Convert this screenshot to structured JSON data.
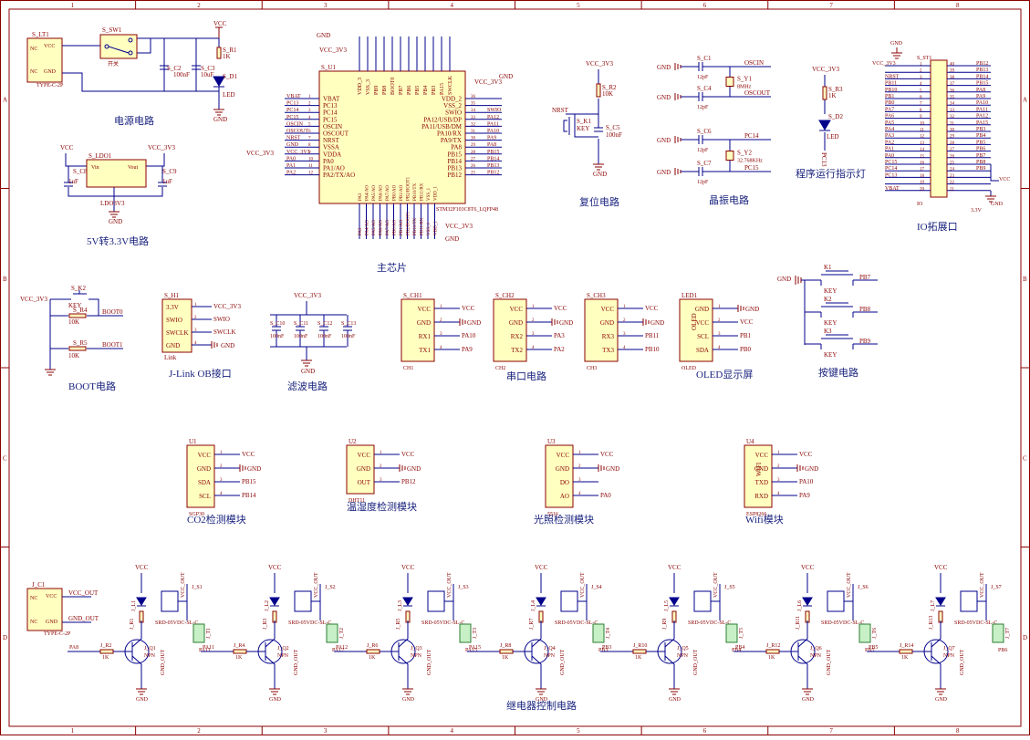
{
  "border": {
    "cols": [
      "1",
      "2",
      "3",
      "4",
      "5",
      "6",
      "7",
      "8"
    ],
    "rows": [
      "A",
      "B",
      "C",
      "D"
    ]
  },
  "sections": {
    "power": "电源电路",
    "ldo": "5V转3.3V电路",
    "mcu": "主芯片",
    "reset": "复位电路",
    "crystal": "晶振电路",
    "led": "程序运行指示灯",
    "io": "IO拓展口",
    "boot": "BOOT电路",
    "jlink": "J-Link OB接口",
    "filter": "滤波电路",
    "uart": "串口电路",
    "oled": "OLED显示屏",
    "keys": "按键电路",
    "co2": "CO2检测模块",
    "dht": "温湿度检测模块",
    "light": "光照检测模块",
    "wifi": "Wifi模块",
    "relay": "继电器控制电路"
  },
  "power": {
    "jack": "S_LT1",
    "jack_type": "TYPE-C-2P",
    "sw": "S_SW1",
    "sw_note": "开关",
    "c2": "S_C2",
    "c2v": "100nF",
    "c3": "S_C3",
    "c3v": "10uF",
    "r1": "S_R1",
    "r1v": "1K",
    "d1": "S_D1",
    "d1v": "LED",
    "vcc": "VCC",
    "gnd": "GND",
    "nc": "NC",
    "vccpin": "VCC",
    "gndpin": "GND"
  },
  "ldo": {
    "name": "S_LDO1",
    "part": "LDO3V3",
    "vin": "Vin",
    "vout": "Vout",
    "c8": "S_C8",
    "c9": "S_C9",
    "cval": "1uF",
    "vcc": "VCC",
    "v33": "VCC_3V3",
    "gnd": "GND"
  },
  "mcu": {
    "ref": "S_U1",
    "part": "STM32F103C8T6_LQFP48",
    "v33": "VCC_3V3",
    "gnd": "GND",
    "top_pins": [
      "VDD_3",
      "VSS_3",
      "PB9",
      "PB8",
      "BOOT0",
      "PB7",
      "PB6",
      "PB5",
      "PB4",
      "PB3",
      "PA15",
      "SWCLK"
    ],
    "left_pins": [
      {
        "n": "1",
        "name": "VBAT",
        "net": "VBAT"
      },
      {
        "n": "2",
        "name": "PC13",
        "net": "PC13"
      },
      {
        "n": "3",
        "name": "PC14",
        "net": "PC14"
      },
      {
        "n": "4",
        "name": "PC15",
        "net": "PC15"
      },
      {
        "n": "5",
        "name": "OSCIN",
        "net": "OSCIN"
      },
      {
        "n": "6",
        "name": "OSCOUT",
        "net": "OSCOUT"
      },
      {
        "n": "7",
        "name": "NRST",
        "net": "NRST"
      },
      {
        "n": "8",
        "name": "VSSA",
        "net": "GND"
      },
      {
        "n": "9",
        "name": "VDDA",
        "net": "VCC_3V3"
      },
      {
        "n": "10",
        "name": "PA0",
        "net": "PA0"
      },
      {
        "n": "11",
        "name": "PA1/AO",
        "net": "PA1"
      },
      {
        "n": "12",
        "name": "PA2/TX/AO",
        "net": "PA2"
      }
    ],
    "right_pins": [
      {
        "n": "36",
        "name": "VDD_2",
        "net": "VCC_3V3"
      },
      {
        "n": "35",
        "name": "VSS_2",
        "net": "GND"
      },
      {
        "n": "34",
        "name": "SWIO",
        "net": "SWIO"
      },
      {
        "n": "33",
        "name": "PA12/USB/DP",
        "net": "PA12"
      },
      {
        "n": "32",
        "name": "PA11/USB/DM",
        "net": "PA11"
      },
      {
        "n": "31",
        "name": "PA10/RX",
        "net": "PA10"
      },
      {
        "n": "30",
        "name": "PA9/TX",
        "net": "PA9"
      },
      {
        "n": "29",
        "name": "PA8",
        "net": "PA8"
      },
      {
        "n": "28",
        "name": "PB15",
        "net": "PB15"
      },
      {
        "n": "27",
        "name": "PB14",
        "net": "PB14"
      },
      {
        "n": "26",
        "name": "PB13",
        "net": "PB13"
      },
      {
        "n": "25",
        "name": "PB12",
        "net": "PB12"
      }
    ],
    "bottom_pins": [
      "PA3",
      "PA4/AO",
      "PA5/AO",
      "PA6/AO",
      "PA7/AO",
      "PB0/AO",
      "PB1/AO",
      "PB2/BOOT1",
      "PB10/TX",
      "PB11/RX",
      "VSS_1",
      "VDD_1"
    ]
  },
  "reset": {
    "v33": "VCC_3V3",
    "r": "S_R2",
    "rv": "10K",
    "k": "S_K1",
    "kv": "KEY",
    "c": "S_C5",
    "cv": "100nF",
    "nrst": "NRST",
    "gnd": "GND"
  },
  "crystal": {
    "c1": "S_C1",
    "c4": "S_C4",
    "c6": "S_C6",
    "c7": "S_C7",
    "cv1": "12pF",
    "y1": "S_Y1",
    "y1v": "8MHz",
    "y2": "S_Y2",
    "y2v": "32.768KHz",
    "oscin": "OSCIN",
    "oscout": "OSCOUT",
    "pc14": "PC14",
    "pc15": "PC15",
    "gnd": "GND"
  },
  "ledind": {
    "v33": "VCC_3V3",
    "r": "S_R3",
    "rv": "1K",
    "d": "S_D2",
    "dv": "LED",
    "net": "PC13"
  },
  "io": {
    "ref": "S_ST1",
    "part": "IO",
    "gnd": "GND",
    "vcc": "VCC",
    "v33": "VCC_3V3",
    "v33b": "3.3V",
    "left": [
      "VCC_3V3",
      "NRST",
      "PB11",
      "PB10",
      "PB1",
      "PB0",
      "PA7",
      "PA6",
      "PA5",
      "PA4",
      "PA3",
      "PA2",
      "PA1",
      "PA0",
      "PC15",
      "PC14",
      "PC13",
      "VBAT"
    ],
    "right": [
      "PB12",
      "PB13",
      "PB14",
      "PB15",
      "PA8",
      "PA9",
      "PA10",
      "PA11",
      "PA12",
      "PA15",
      "PB3",
      "PB4",
      "PB5",
      "PB6",
      "PB7",
      "PB8",
      "PB9"
    ]
  },
  "boot": {
    "v33": "VCC_3V3",
    "k": "S_K2",
    "kv": "KEY",
    "r4": "S_R4",
    "r5": "S_R5",
    "rv": "10K",
    "b0": "BOOT0",
    "b1": "BOOT1"
  },
  "jlink": {
    "ref": "S_H1",
    "part": "Link",
    "pins": [
      "3.3V",
      "SWIO",
      "SWCLK",
      "GND"
    ],
    "nets": [
      "VCC_3V3",
      "SWIO",
      "SWCLK",
      "GND"
    ]
  },
  "filter": {
    "v33": "VCC_3V3",
    "caps": [
      "S_C10",
      "S_C11",
      "S_C12",
      "S_C13"
    ],
    "cv": "100nF",
    "gnd": "GND"
  },
  "uart": [
    {
      "ref": "S_CH1",
      "part": "CH1",
      "pins": [
        "VCC",
        "GND",
        "RX1",
        "TX1"
      ],
      "nets": [
        "VCC",
        "GND",
        "PA10",
        "PA9"
      ]
    },
    {
      "ref": "S_CH2",
      "part": "CH2",
      "pins": [
        "VCC",
        "GND",
        "RX2",
        "TX2"
      ],
      "nets": [
        "VCC",
        "GND",
        "PA3",
        "PA2"
      ]
    },
    {
      "ref": "S_CH3",
      "part": "CH3",
      "pins": [
        "VCC",
        "GND",
        "RX3",
        "TX3"
      ],
      "nets": [
        "VCC",
        "GND",
        "PB11",
        "PB10"
      ]
    }
  ],
  "oled": {
    "ref": "LED1",
    "part": "OLED",
    "inner": "OLED",
    "pins": [
      "GND",
      "VCC",
      "SCL",
      "SDA"
    ],
    "nets": [
      "GND",
      "VCC",
      "PB1",
      "PB0"
    ]
  },
  "keys": {
    "refs": [
      "K1",
      "K2",
      "K3"
    ],
    "kv": "KEY",
    "nets": [
      "PB7",
      "PB8",
      "PB9"
    ],
    "gnd": "GND"
  },
  "modules": [
    {
      "ref": "U1",
      "part": "SGP30",
      "pins": [
        "VCC",
        "GND",
        "SDA",
        "SCL"
      ],
      "nets": [
        "VCC",
        "GND",
        "PB15",
        "PB14"
      ]
    },
    {
      "ref": "U2",
      "part": "DHT11",
      "pins": [
        "VCC",
        "GND",
        "OUT"
      ],
      "nets": [
        "VCC",
        "GND",
        "PB12"
      ]
    },
    {
      "ref": "U3",
      "part": "5516",
      "pins": [
        "VCC",
        "GND",
        "DO",
        "AO"
      ],
      "nets": [
        "VCC",
        "GND",
        "",
        "PA0"
      ]
    },
    {
      "ref": "U4",
      "part": "ESP8266",
      "inner": "WIFI",
      "pins": [
        "VCC",
        "GND",
        "TXD",
        "RXD"
      ],
      "nets": [
        "VCC",
        "GND",
        "PA10",
        "PA9"
      ]
    }
  ],
  "relay_power": {
    "ref": "J_C1",
    "type": "TYPE-C-2P",
    "vout": "VCC_OUT",
    "gout": "GND_OUT",
    "nc": "NC",
    "vcc": "VCC",
    "gnd": "GND"
  },
  "relays": [
    {
      "d": "J_L1",
      "r1": "J_R1",
      "r2": "J_R2",
      "q": "J_Q1",
      "s": "J_S1",
      "t": "J_T1",
      "in": "PA8",
      "out": "PA11"
    },
    {
      "d": "J_L2",
      "r1": "J_R3",
      "r2": "J_R4",
      "q": "J_Q2",
      "s": "J_S2",
      "t": "J_T2",
      "in": "PA11",
      "out": "PA12"
    },
    {
      "d": "J_L3",
      "r1": "J_R5",
      "r2": "J_R6",
      "q": "J_Q3",
      "s": "J_S3",
      "t": "J_T3",
      "in": "PA12",
      "out": "PA15"
    },
    {
      "d": "J_L4",
      "r1": "J_R7",
      "r2": "J_R8",
      "q": "J_Q4",
      "s": "J_S4",
      "t": "J_T4",
      "in": "PA15",
      "out": "PB3"
    },
    {
      "d": "J_L5",
      "r1": "J_R9",
      "r2": "J_R10",
      "q": "J_Q5",
      "s": "J_S5",
      "t": "J_T5",
      "in": "PB3",
      "out": "PB4"
    },
    {
      "d": "J_L6",
      "r1": "J_R11",
      "r2": "J_R12",
      "q": "J_Q6",
      "s": "J_S6",
      "t": "J_T6",
      "in": "PB4",
      "out": "PB5"
    },
    {
      "d": "J_L7",
      "r1": "J_R13",
      "r2": "J_R14",
      "q": "J_Q7",
      "s": "J_S7",
      "t": "J_T7",
      "in": "PB5",
      "out": "PB6"
    }
  ],
  "relay_common": {
    "vcc": "VCC",
    "gnd": "GND",
    "rv": "1K",
    "npn": "NPN",
    "relay": "SRD-05VDC-SL-C",
    "vout": "VCC_OUT",
    "gout": "GND_OUT"
  }
}
